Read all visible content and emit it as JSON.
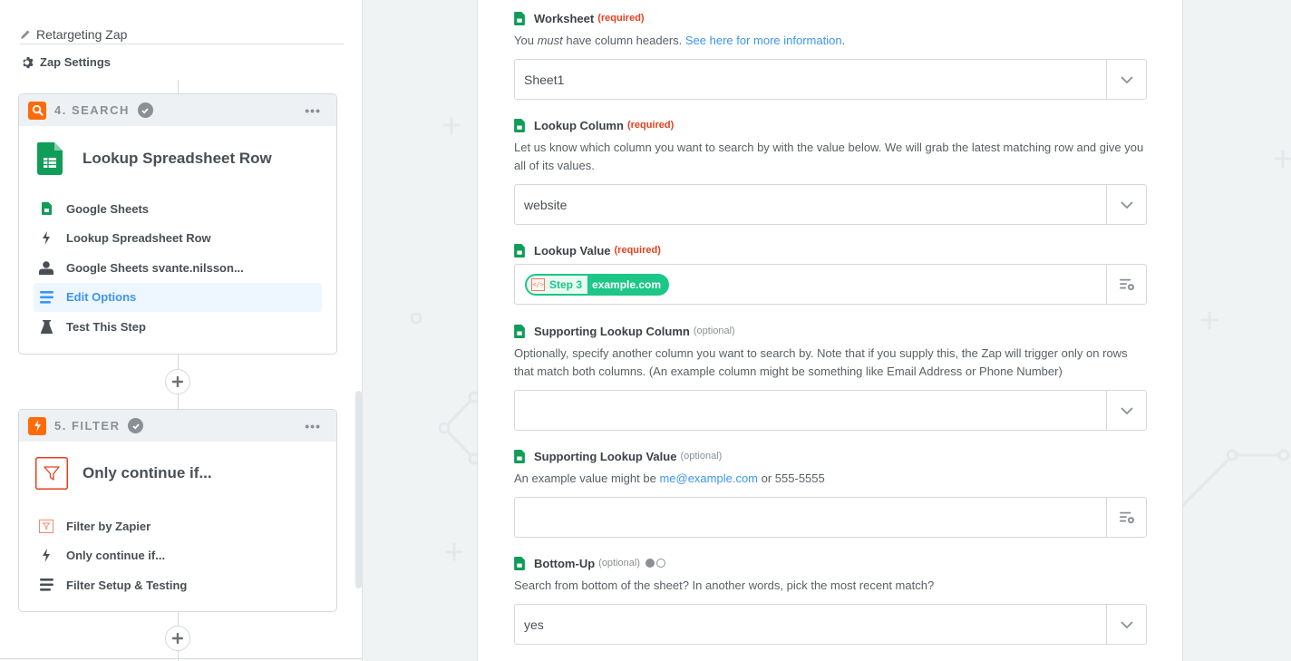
{
  "sidebar": {
    "zap_name": "Retargeting Zap",
    "zap_settings_label": "Zap Settings",
    "steps": [
      {
        "badge_icon": "search-icon",
        "label": "4. SEARCH",
        "status_icon": "check-icon",
        "more_label": "•••",
        "title": "Lookup Spreadsheet Row",
        "title_icon": "google-sheets-icon",
        "items": [
          {
            "icon": "google-sheets-icon",
            "label": "Google Sheets"
          },
          {
            "icon": "bolt-icon",
            "label": "Lookup Spreadsheet Row"
          },
          {
            "icon": "user-icon",
            "label": "Google Sheets svante.nilsson..."
          },
          {
            "icon": "lines-icon",
            "label": "Edit Options",
            "active": true
          },
          {
            "icon": "flask-icon",
            "label": "Test This Step"
          }
        ]
      },
      {
        "badge_icon": "bolt-icon",
        "label": "5. FILTER",
        "status_icon": "check-icon",
        "more_label": "•••",
        "title": "Only continue if...",
        "title_icon": "filter-icon",
        "items": [
          {
            "icon": "filter-icon",
            "label": "Filter by Zapier"
          },
          {
            "icon": "bolt-icon",
            "label": "Only continue if..."
          },
          {
            "icon": "lines-icon",
            "label": "Filter Setup & Testing"
          }
        ]
      }
    ]
  },
  "form": {
    "worksheet": {
      "label": "Worksheet",
      "tag": "(required)",
      "help_pre": "You ",
      "help_em": "must",
      "help_post": " have column headers. ",
      "help_link": "See here for more information",
      "help_end": ".",
      "value": "Sheet1"
    },
    "lookup_column": {
      "label": "Lookup Column",
      "tag": "(required)",
      "help": "Let us know which column you want to search by with the value below. We will grab the latest matching row and give you all of its values.",
      "value": "website"
    },
    "lookup_value": {
      "label": "Lookup Value",
      "tag": "(required)",
      "pill_step": "Step 3",
      "pill_value": "example.com",
      "pill_icon_text": "</>"
    },
    "supporting_lookup_column": {
      "label": "Supporting Lookup Column",
      "tag": "(optional)",
      "help": "Optionally, specify another column you want to search by. Note that if you supply this, the Zap will trigger only on rows that match both columns. (An example column might be something like Email Address or Phone Number)",
      "value": ""
    },
    "supporting_lookup_value": {
      "label": "Supporting Lookup Value",
      "tag": "(optional)",
      "help_pre": "An example value might be ",
      "help_link": "me@example.com",
      "help_post": " or 555-5555",
      "value": ""
    },
    "bottom_up": {
      "label": "Bottom-Up",
      "tag": "(optional)",
      "help": "Search from bottom of the sheet? In another words, pick the most recent match?",
      "value": "yes"
    }
  },
  "colors": {
    "accent_blue": "#3b96f0",
    "required_red": "#e5401f",
    "step_orange": "#ff6b0a",
    "pill_green": "#1cc787",
    "sheets_green": "#0f9d58"
  }
}
